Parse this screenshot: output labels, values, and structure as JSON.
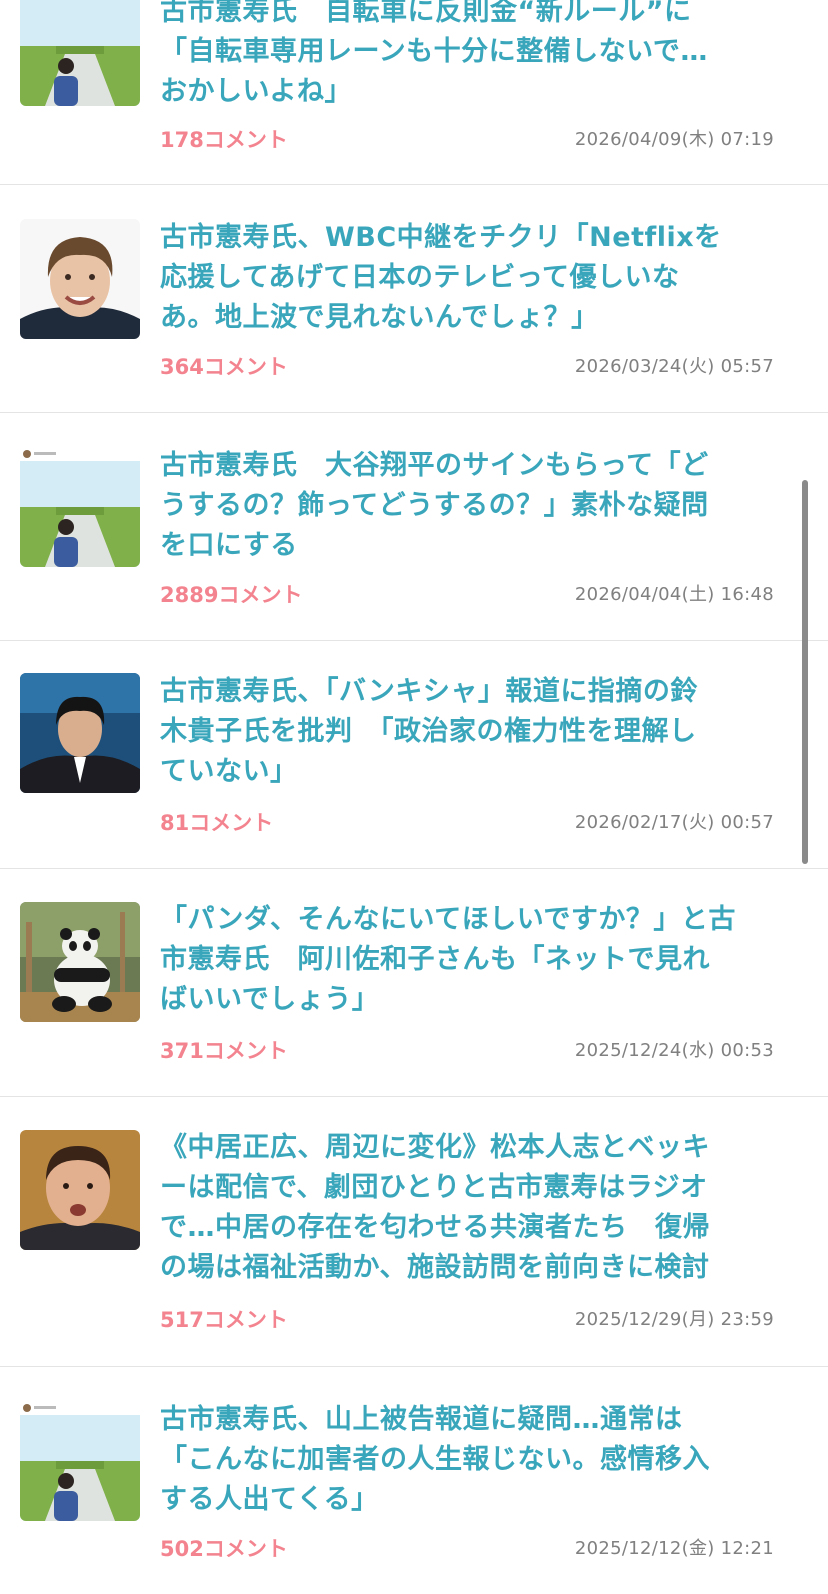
{
  "articles": [
    {
      "title": "古市憲寿氏　自転車に反則金“新ルール”に\n「自転車専用レーンも十分に整備しないで…\nおかしいよね」",
      "comments": "178",
      "comment_suffix": "コメント",
      "date": "2026/04/09(木) 07:19",
      "thumbnail": "sns-post-field-photo"
    },
    {
      "title": "古市憲寿氏、WBC中継をチクリ「Netflixを\n応援してあげて日本のテレビって優しいな\nあ。地上波で見れないんでしょ？」",
      "comments": "364",
      "comment_suffix": "コメント",
      "date": "2026/03/24(火) 05:57",
      "thumbnail": "smiling-man-portrait"
    },
    {
      "title": "古市憲寿氏　大谷翔平のサインもらって「ど\nうするの？飾ってどうするの？」素朴な疑問\nを口にする",
      "comments": "2889",
      "comment_suffix": "コメント",
      "date": "2026/04/04(土) 16:48",
      "thumbnail": "sns-post-field-photo"
    },
    {
      "title": "古市憲寿氏、「バンキシャ」報道に指摘の鈴\n木貴子氏を批判　「政治家の権力性を理解し\nていない」",
      "comments": "81",
      "comment_suffix": "コメント",
      "date": "2026/02/17(火) 00:57",
      "thumbnail": "man-on-tv-set"
    },
    {
      "title": "「パンダ、そんなにいてほしいですか？」と古\n市憲寿氏　阿川佐和子さんも「ネットで見れ\nばいいでしょう」",
      "comments": "371",
      "comment_suffix": "コメント",
      "date": "2025/12/24(水) 00:53",
      "thumbnail": "giant-panda"
    },
    {
      "title": "《中居正広、周辺に変化》松本人志とベッキ\nーは配信で、劇団ひとりと古市憲寿はラジオ\nで…中居の存在を匂わせる共演者たち　復帰\nの場は福祉活動か、施設訪問を前向きに検討",
      "comments": "517",
      "comment_suffix": "コメント",
      "date": "2025/12/29(月) 23:59",
      "thumbnail": "man-speaking-portrait"
    },
    {
      "title": "古市憲寿氏、山上被告報道に疑問…通常は\n「こんなに加害者の人生報じない。感情移入\nする人出てくる」",
      "comments": "502",
      "comment_suffix": "コメント",
      "date": "2025/12/12(金) 12:21",
      "thumbnail": "sns-post-field-photo"
    }
  ],
  "colors": {
    "title": "#3aa6bb",
    "comments": "#f3848f",
    "date": "#808080",
    "divider": "#e4e4e4"
  }
}
